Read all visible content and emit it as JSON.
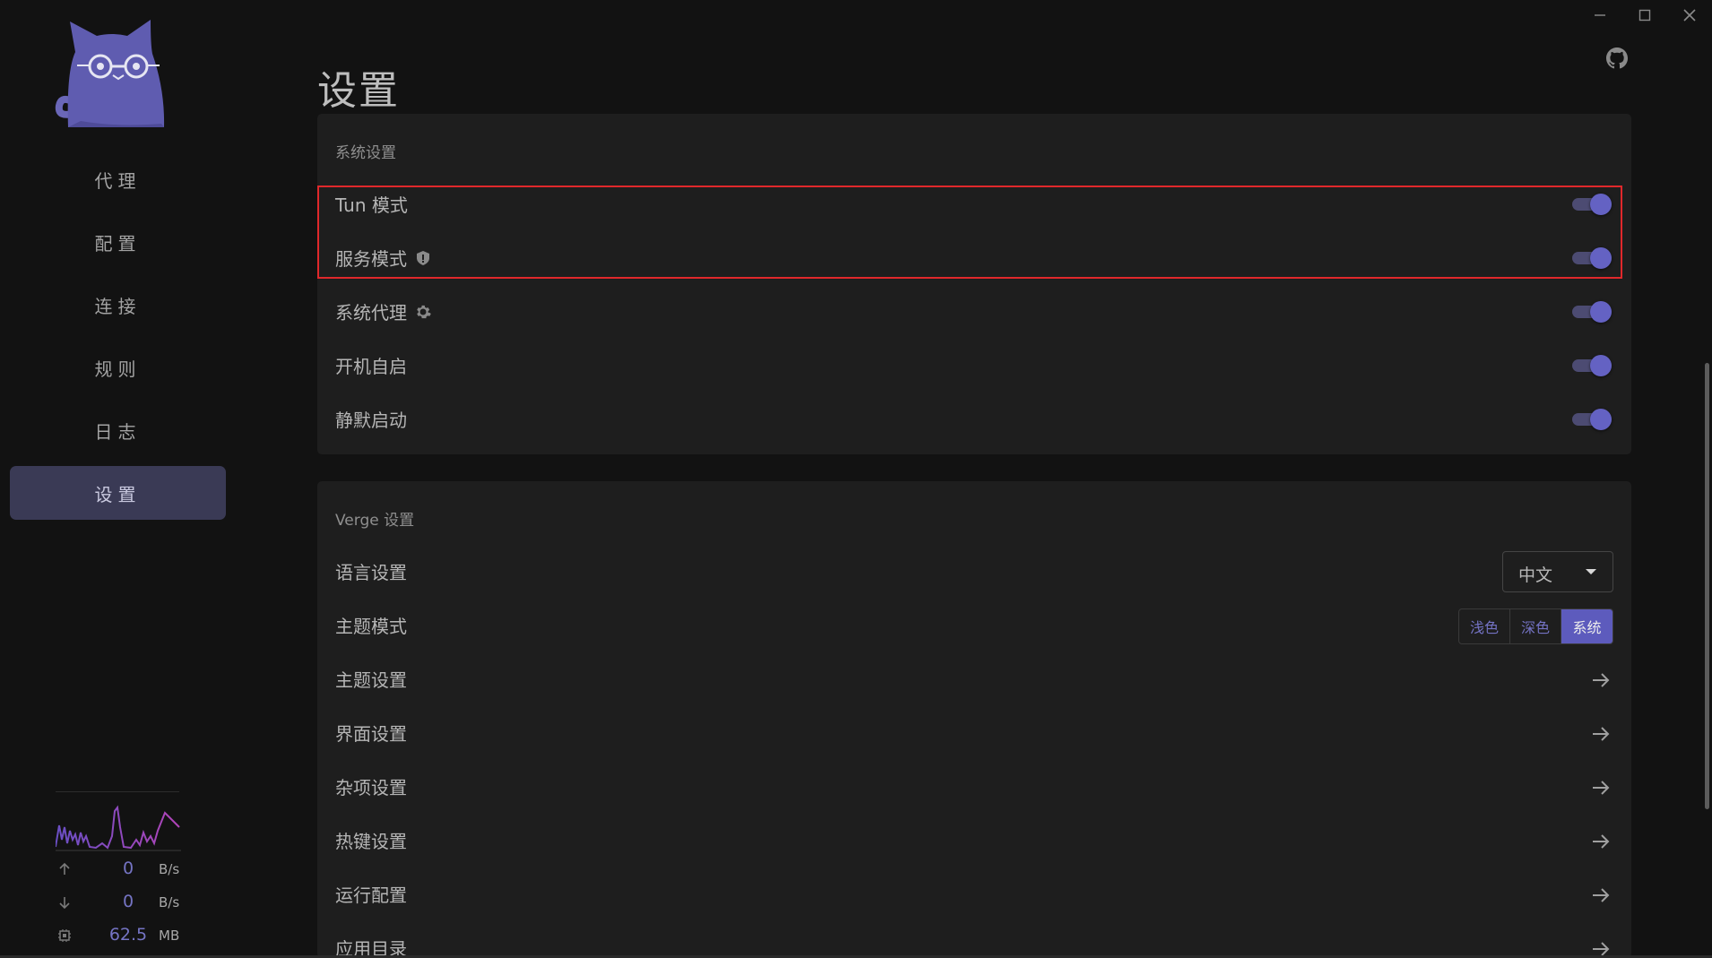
{
  "window": {
    "minimize_icon": "minimize-icon",
    "maximize_icon": "maximize-icon",
    "close_icon": "close-icon"
  },
  "page_title": "设置",
  "sidebar": {
    "items": [
      {
        "label": "代理"
      },
      {
        "label": "配置"
      },
      {
        "label": "连接"
      },
      {
        "label": "规则"
      },
      {
        "label": "日志"
      },
      {
        "label": "设置",
        "active": true
      }
    ],
    "traffic": {
      "upload_value": "0",
      "upload_unit": "B/s",
      "download_value": "0",
      "download_unit": "B/s",
      "memory_value": "62.5",
      "memory_unit": "MB"
    }
  },
  "system_settings": {
    "title": "系统设置",
    "rows": [
      {
        "label": "Tun 模式",
        "enabled": true
      },
      {
        "label": "服务模式",
        "icon": "shield-icon",
        "enabled": true
      },
      {
        "label": "系统代理",
        "icon": "gear-icon",
        "enabled": true
      },
      {
        "label": "开机自启",
        "enabled": true
      },
      {
        "label": "静默启动",
        "enabled": true
      }
    ]
  },
  "verge_settings": {
    "title": "Verge 设置",
    "language": {
      "label": "语言设置",
      "value": "中文"
    },
    "theme_mode": {
      "label": "主题模式",
      "options": [
        "浅色",
        "深色",
        "系统"
      ],
      "selected": "系统"
    },
    "links": [
      {
        "label": "主题设置"
      },
      {
        "label": "界面设置"
      },
      {
        "label": "杂项设置"
      },
      {
        "label": "热键设置"
      },
      {
        "label": "运行配置"
      },
      {
        "label": "应用目录"
      }
    ]
  },
  "colors": {
    "accent": "#5d5bbd",
    "highlight_border": "#e0282b",
    "background": "#121212",
    "card": "#1e1e1e"
  }
}
